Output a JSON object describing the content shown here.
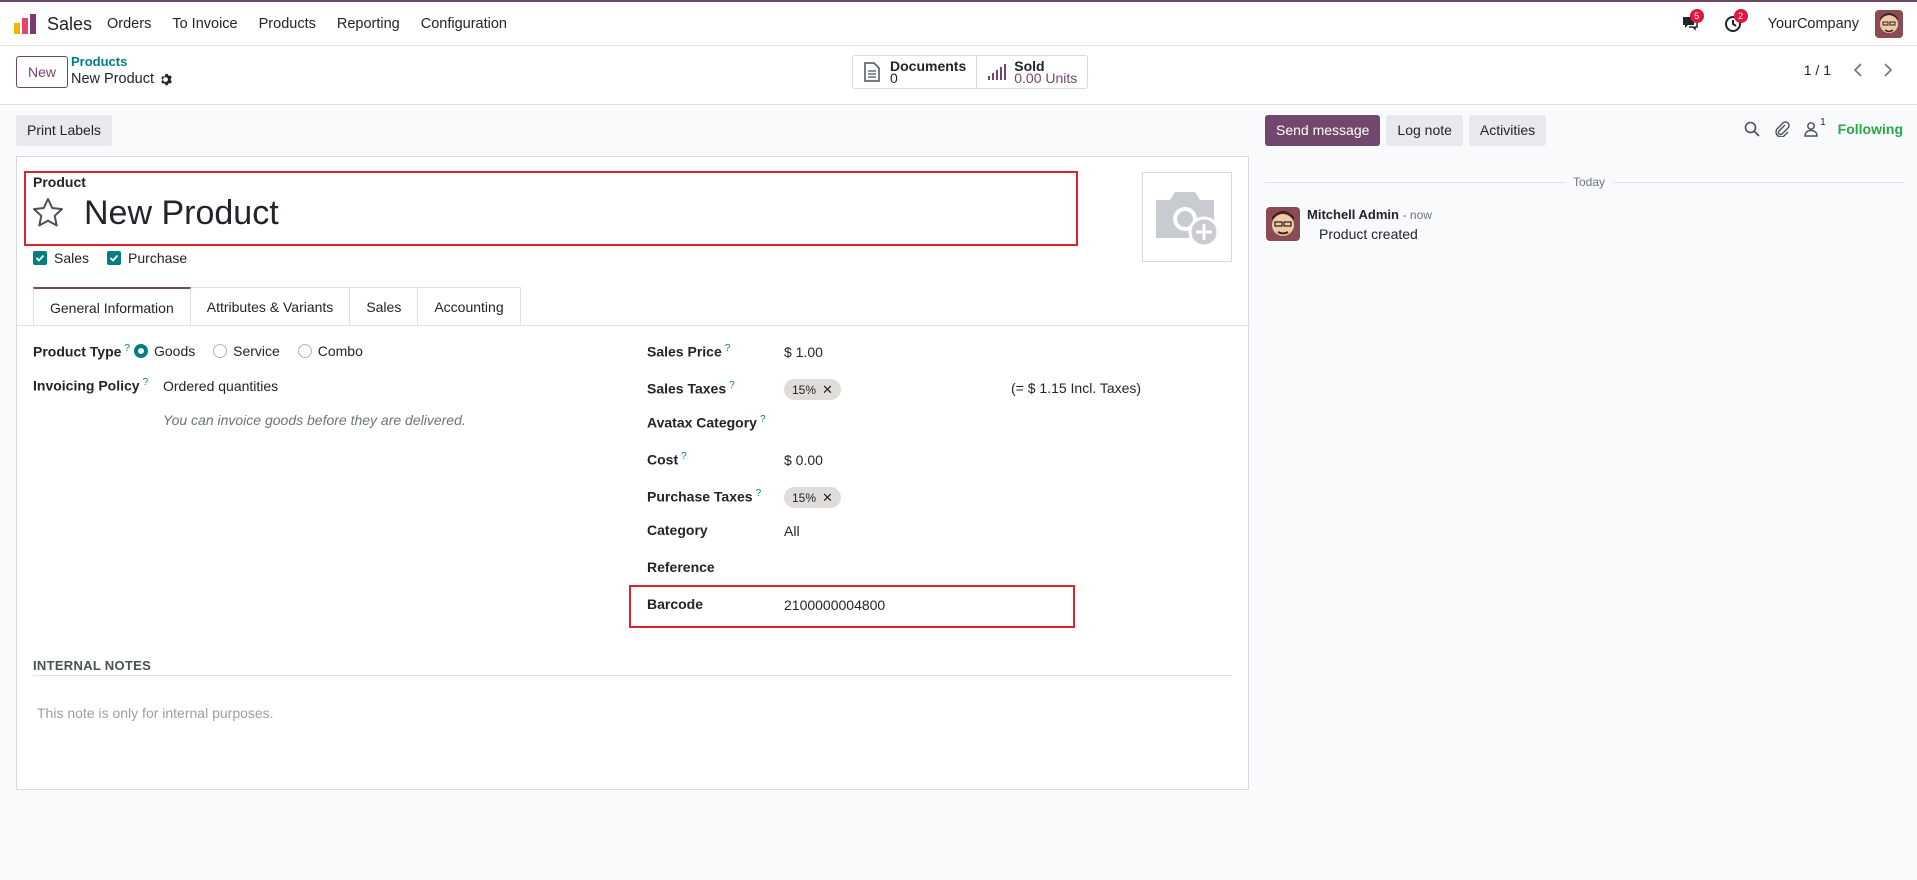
{
  "nav": {
    "app_name": "Sales",
    "items": [
      "Orders",
      "To Invoice",
      "Products",
      "Reporting",
      "Configuration"
    ],
    "messages_count": "5",
    "activities_count": "2",
    "company": "YourCompany"
  },
  "control_panel": {
    "new_label": "New",
    "breadcrumb_parent": "Products",
    "breadcrumb_current": "New Product",
    "smart_buttons": [
      {
        "label": "Documents",
        "value": "0"
      },
      {
        "label": "Sold",
        "value": "0.00 Units"
      }
    ],
    "pager": "1 / 1"
  },
  "form": {
    "print_labels": "Print Labels",
    "product_label": "Product",
    "product_name": "New Product",
    "checkbox_sales": "Sales",
    "checkbox_purchase": "Purchase",
    "tabs": [
      "General Information",
      "Attributes & Variants",
      "Sales",
      "Accounting"
    ],
    "product_type_label": "Product Type",
    "product_type_options": [
      "Goods",
      "Service",
      "Combo"
    ],
    "invoicing_policy_label": "Invoicing Policy",
    "invoicing_policy_value": "Ordered quantities",
    "invoicing_note": "You can invoice goods before they are delivered.",
    "sales_price_label": "Sales Price",
    "sales_price_value": "$ 1.00",
    "sales_taxes_label": "Sales Taxes",
    "sales_taxes_tag": "15%",
    "sales_taxes_incl": "(= $ 1.15 Incl. Taxes)",
    "avatax_label": "Avatax Category",
    "cost_label": "Cost",
    "cost_value": "$ 0.00",
    "purchase_taxes_label": "Purchase Taxes",
    "purchase_taxes_tag": "15%",
    "category_label": "Category",
    "category_value": "All",
    "reference_label": "Reference",
    "barcode_label": "Barcode",
    "barcode_value": "2100000004800",
    "internal_notes_title": "INTERNAL NOTES",
    "internal_notes_placeholder": "This note is only for internal purposes."
  },
  "chatter": {
    "send_message": "Send message",
    "log_note": "Log note",
    "activities": "Activities",
    "followers_count": "1",
    "following": "Following",
    "today": "Today",
    "author": "Mitchell Admin",
    "time": "- now",
    "body": "Product created"
  },
  "colors": {
    "brand": "#71486b",
    "teal": "#017e84",
    "highlight": "#d9232d",
    "following": "#28a745"
  }
}
